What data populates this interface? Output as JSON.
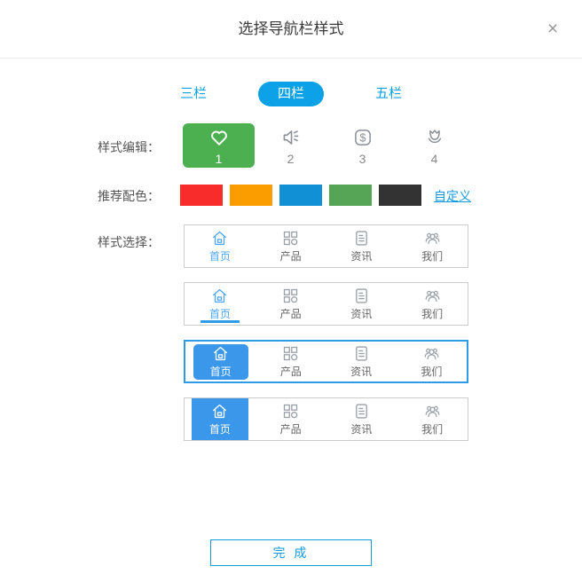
{
  "dialog": {
    "title": "选择导航栏样式",
    "close_glyph": "×"
  },
  "tabs": [
    {
      "label": "三栏",
      "active": false
    },
    {
      "label": "四栏",
      "active": true
    },
    {
      "label": "五栏",
      "active": false
    }
  ],
  "style_edit": {
    "label": "样式编辑：",
    "options": [
      {
        "num": "1",
        "icon": "heart-icon",
        "selected": true
      },
      {
        "num": "2",
        "icon": "speaker-icon",
        "selected": false
      },
      {
        "num": "3",
        "icon": "dollar-icon",
        "selected": false
      },
      {
        "num": "4",
        "icon": "flower-icon",
        "selected": false
      }
    ]
  },
  "palette": {
    "label": "推荐配色：",
    "colors": [
      "#f92c2c",
      "#fb9c00",
      "#1190d5",
      "#56a556",
      "#333333"
    ],
    "custom_link": "自定义"
  },
  "style_select": {
    "label": "样式选择：",
    "nav_items": [
      {
        "label": "首页",
        "icon": "home-icon"
      },
      {
        "label": "产品",
        "icon": "grid-icon"
      },
      {
        "label": "资讯",
        "icon": "news-icon"
      },
      {
        "label": "我们",
        "icon": "people-icon"
      }
    ],
    "rows": [
      {
        "name": "nav-style-plain",
        "active_style": "plain",
        "selected": false
      },
      {
        "name": "nav-style-underline",
        "active_style": "underline",
        "selected": false
      },
      {
        "name": "nav-style-rounded",
        "active_style": "rounded",
        "selected": true
      },
      {
        "name": "nav-style-square",
        "active_style": "square",
        "selected": false
      }
    ]
  },
  "footer": {
    "done_label": "完 成"
  },
  "colors": {
    "accent_blue": "#0da2e7",
    "selected_green": "#4caf50",
    "nav_active_fill": "#3b97ea",
    "row_selected_border": "#2d9be8"
  }
}
